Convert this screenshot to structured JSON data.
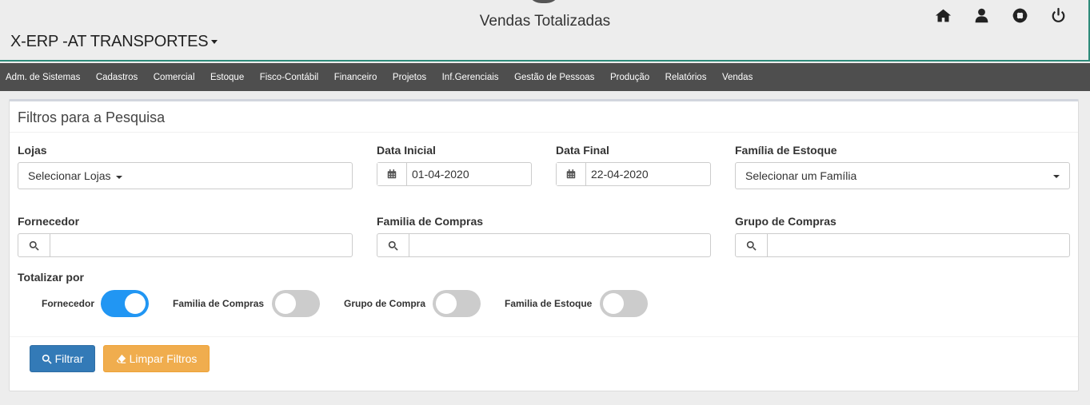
{
  "header": {
    "page_title": "Vendas Totalizadas",
    "company": "X-ERP -AT TRANSPORTES",
    "icons": [
      "home-icon",
      "user-icon",
      "support-icon",
      "power-icon"
    ]
  },
  "menu": [
    "Adm. de Sistemas",
    "Cadastros",
    "Comercial",
    "Estoque",
    "Fisco-Contábil",
    "Financeiro",
    "Projetos",
    "Inf.Gerenciais",
    "Gestão de Pessoas",
    "Produção",
    "Relatórios",
    "Vendas"
  ],
  "panel": {
    "title": "Filtros para a Pesquisa",
    "lojas": {
      "label": "Lojas",
      "value": "Selecionar Lojas"
    },
    "data_inicial": {
      "label": "Data Inicial",
      "value": "01-04-2020"
    },
    "data_final": {
      "label": "Data Final",
      "value": "22-04-2020"
    },
    "familia_estoque": {
      "label": "Família de Estoque",
      "value": "Selecionar um Família"
    },
    "fornecedor": {
      "label": "Fornecedor",
      "value": ""
    },
    "familia_compras": {
      "label": "Familia de Compras",
      "value": ""
    },
    "grupo_compras": {
      "label": "Grupo de Compras",
      "value": ""
    },
    "totalizar": {
      "label": "Totalizar por",
      "options": [
        {
          "label": "Fornecedor",
          "on": true
        },
        {
          "label": "Familia de Compras",
          "on": false
        },
        {
          "label": "Grupo de Compra",
          "on": false
        },
        {
          "label": "Familia de Estoque",
          "on": false
        }
      ]
    },
    "buttons": {
      "filtrar": "Filtrar",
      "limpar": "Limpar Filtros"
    }
  },
  "colors": {
    "accent": "#2e8b7a",
    "menu_bg": "#4e4e4e",
    "toggle_on": "#2196f3",
    "primary": "#337ab7",
    "warning": "#f0ad4e"
  }
}
